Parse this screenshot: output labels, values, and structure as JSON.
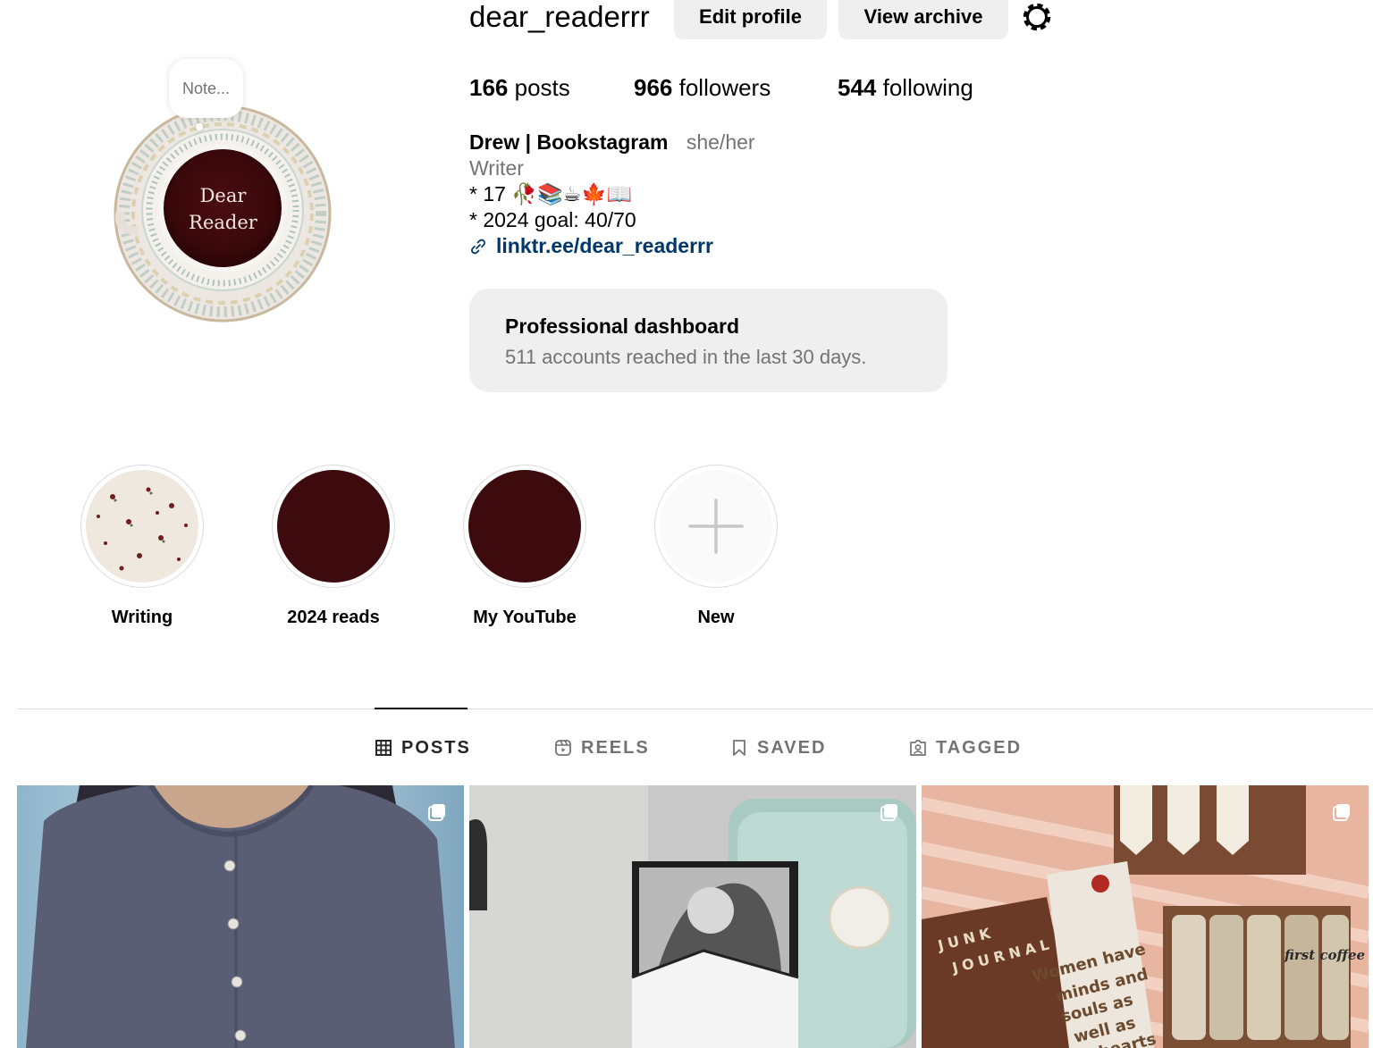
{
  "profile": {
    "username": "dear_readerrr",
    "edit_label": "Edit profile",
    "archive_label": "View archive",
    "note_placeholder": "Note...",
    "avatar_text_line1": "Dear",
    "avatar_text_line2": "Reader"
  },
  "stats": {
    "posts_count": "166",
    "posts_label": "posts",
    "followers_count": "966",
    "followers_label": "followers",
    "following_count": "544",
    "following_label": "following"
  },
  "bio": {
    "name": "Drew | Bookstagram",
    "pronouns": "she/her",
    "category": "Writer",
    "line1": "* 17 🥀📚☕🍁📖",
    "line2": "* 2024 goal: 40/70",
    "link": "linktr.ee/dear_readerrr"
  },
  "dashboard": {
    "title": "Professional dashboard",
    "subtitle": "511 accounts reached in the last 30 days."
  },
  "highlights": [
    {
      "label": "Writing"
    },
    {
      "label": "2024 reads"
    },
    {
      "label": "My YouTube"
    },
    {
      "label": "New"
    }
  ],
  "tabs": {
    "posts": "POSTS",
    "reels": "REELS",
    "saved": "SAVED",
    "tagged": "TAGGED"
  },
  "colors": {
    "link": "#00376b",
    "secondary_text": "#737373",
    "button_bg": "#efefef",
    "highlight_dark": "#3d0b0d"
  },
  "posts": {
    "post3_text_1": "JUNK",
    "post3_text_2": "JOURNAL",
    "post3_text_3": "Women have",
    "post3_text_4": "minds and",
    "post3_text_5": "souls as",
    "post3_text_6": "well as",
    "post3_text_7": "hearts",
    "post3_tape_text": "first coffee"
  }
}
